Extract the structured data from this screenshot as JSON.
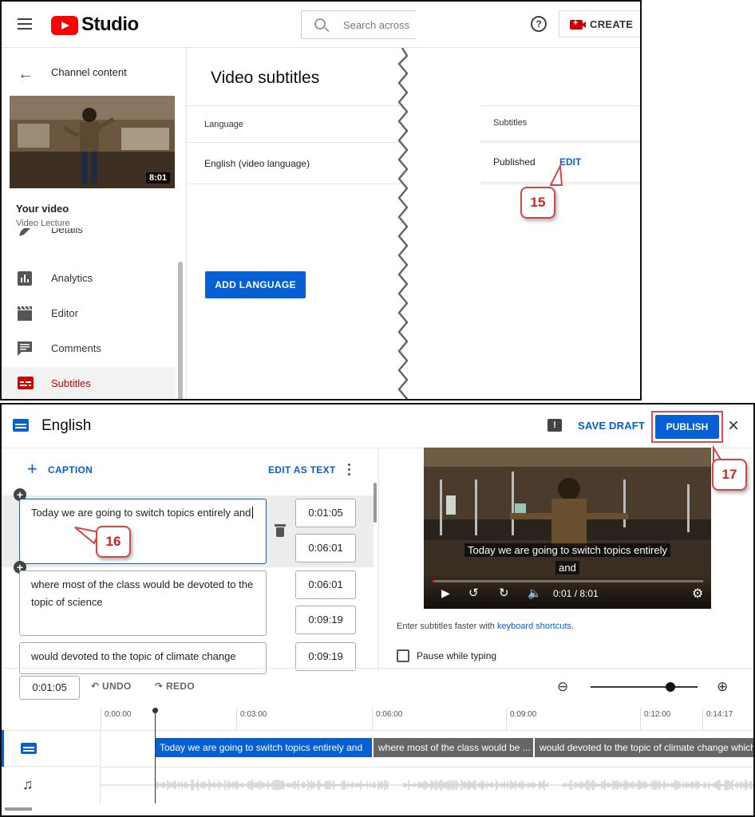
{
  "top": {
    "brand": "Studio",
    "search_placeholder": "Search across",
    "help_glyph": "?",
    "create_label": "CREATE",
    "sidebar": {
      "back_label": "Channel content",
      "thumb_duration": "8:01",
      "your_video": "Your video",
      "video_title": "Video Lecture",
      "items": [
        {
          "label": "Details",
          "icon": "pencil-icon"
        },
        {
          "label": "Analytics",
          "icon": "analytics-icon"
        },
        {
          "label": "Editor",
          "icon": "clapper-icon"
        },
        {
          "label": "Comments",
          "icon": "comment-icon"
        },
        {
          "label": "Subtitles",
          "icon": "subtitles-icon",
          "active": true
        }
      ]
    },
    "main": {
      "title": "Video subtitles",
      "col_language": "Language",
      "col_subtitles": "Subtitles",
      "row_language": "English (video language)",
      "row_status": "Published",
      "row_action": "EDIT",
      "add_language": "ADD LANGUAGE"
    }
  },
  "callouts": {
    "c15": "15",
    "c16": "16",
    "c17": "17"
  },
  "editor": {
    "title": "English",
    "save_draft": "SAVE DRAFT",
    "publish": "PUBLISH",
    "add_caption": "CAPTION",
    "edit_as_text": "EDIT AS TEXT",
    "captions": [
      {
        "text": "Today we are going to switch topics entirely and",
        "start": "0:01:05",
        "end": "0:06:01"
      },
      {
        "text": "where most of the class would be devoted to the topic of science",
        "start": "0:06:01",
        "end": "0:09:19"
      },
      {
        "text": "would devoted to the topic of climate change",
        "start": "0:09:19",
        "end": ""
      }
    ],
    "video": {
      "subtitle_line1": "Today we are going to switch topics entirely",
      "subtitle_line2": "and",
      "time": "0:01 / 8:01",
      "progress": 0.002
    },
    "hint_prefix": "Enter subtitles faster with ",
    "hint_link": "keyboard shortcuts",
    "hint_suffix": ".",
    "pause_while_typing": "Pause while typing",
    "timeline": {
      "current_time": "0:01:05",
      "undo": "UNDO",
      "redo": "REDO",
      "ticks": [
        "0:00:00",
        "0:03:00",
        "0:06:00",
        "0:09:00",
        "0:12:00",
        "0:14:17"
      ],
      "segments": [
        "Today we are going to switch topics entirely and",
        "where most of the class would be ...",
        "would devoted to the topic of climate change which"
      ]
    }
  },
  "colors": {
    "accent": "#065fd4",
    "brand_red": "#ff0000",
    "callout": "#d64545"
  }
}
